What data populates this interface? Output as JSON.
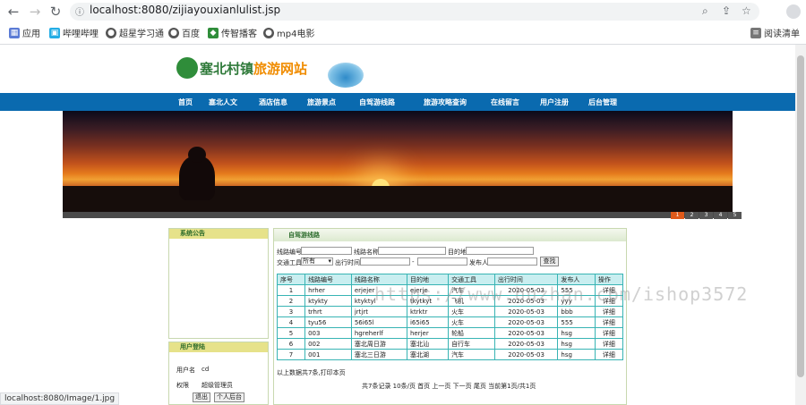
{
  "browser": {
    "url": "localhost:8080/zijiayouxianlulist.jsp",
    "bookmarks": [
      "应用",
      "哔哩哔哩",
      "超星学习通",
      "百度",
      "传智播客",
      "mp4电影"
    ],
    "reading_list": "阅读清单"
  },
  "site": {
    "title_prefix": "塞北村镇",
    "title_suffix": "旅游网站",
    "nav": [
      "首页",
      "塞北人文",
      "酒店信息",
      "旅游景点",
      "自驾游线路",
      "旅游攻略查询",
      "在线留言",
      "用户注册",
      "后台管理"
    ],
    "banner_pages": [
      "1",
      "2",
      "3",
      "4",
      "5"
    ]
  },
  "sidebar": {
    "notice_title": "系统公告",
    "login_title": "用户登陆",
    "username_label": "用户名",
    "username_value": "cd",
    "role_label": "权限",
    "role_value": "超级管理员",
    "logout": "退出",
    "profile": "个人后台"
  },
  "main": {
    "title": "自驾游线路",
    "search": {
      "route_no_label": "线路编号",
      "route_name_label": "线路名称",
      "dest_label": "目的地",
      "transport_label": "交通工具",
      "transport_value": "所有",
      "time_label": "出行时间",
      "publisher_label": "发布人",
      "search_btn": "查找"
    },
    "columns": [
      "序号",
      "线路编号",
      "线路名称",
      "目的地",
      "交通工具",
      "出行时间",
      "发布人",
      "操作"
    ],
    "rows": [
      [
        "1",
        "hrher",
        "erjejer",
        "ejerje",
        "汽车",
        "2020-05-03",
        "555",
        "详细"
      ],
      [
        "2",
        "ktykty",
        "ktyktyl",
        "tkytkyt",
        "飞机",
        "2020-05-03",
        "yyy",
        "详细"
      ],
      [
        "3",
        "trhrt",
        "jrtjrt",
        "ktrktr",
        "火车",
        "2020-05-03",
        "bbb",
        "详细"
      ],
      [
        "4",
        "tyu56",
        "56i65l",
        "i65i65",
        "火车",
        "2020-05-03",
        "555",
        "详细"
      ],
      [
        "5",
        "003",
        "hgreherlf",
        "herjer",
        "轮船",
        "2020-05-03",
        "hsg",
        "详细"
      ],
      [
        "6",
        "002",
        "塞北周日游",
        "塞北汕",
        "自行车",
        "2020-05-03",
        "hsg",
        "详细"
      ],
      [
        "7",
        "001",
        "塞北三日游",
        "塞北湖",
        "汽车",
        "2020-05-03",
        "hsg",
        "详细"
      ]
    ],
    "summary": "以上数据共7条,打印本页",
    "pagination": "共7条记录 10条/页 首页 上一页 下一页 尾页 当前第1页/共1页"
  },
  "watermark": "https://www.huzhan.com/ishop3572",
  "status_url": "localhost:8080/Image/1.jpg"
}
